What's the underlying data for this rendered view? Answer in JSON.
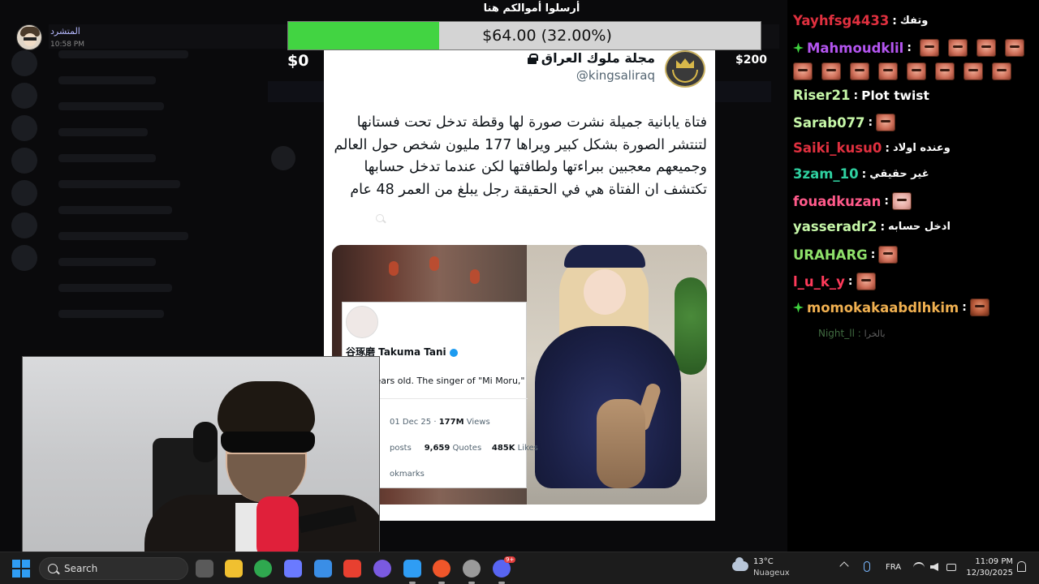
{
  "streamer": {
    "name": "المتشرد",
    "time": "10:58 PM"
  },
  "donation": {
    "title": "أرسلوا أموالكم هنا",
    "progress_text": "$64.00 (32.00%)",
    "progress_fraction": 0.32,
    "min_label": "$0",
    "max_label": "$200"
  },
  "tweet": {
    "display_name": "مجلة ملوك العراق",
    "handle": "@kingsaliraq",
    "body": "فتاة يابانية جميلة نشرت صورة لها وقطة تدخل تحت فستانها لتنتشر الصورة بشكل كبير ويراها 177 مليون شخص حول العالم وجميعهم معجبين ببراءتها ولطافتها لكن عندما تدخل حسابها تكتشف ان الفتاة هي في الحقيقة رجل يبلغ من العمر 48 عام",
    "embedded": {
      "name": "谷琢磨 Takuma Tani",
      "bio": "years old. The singer of \"Mi Moru,\"",
      "date": "01 Dec 25 · ",
      "views_count": "177M",
      "views_label": " Views",
      "posts_label": "posts",
      "quotes_count": "9,659",
      "quotes_label": " Quotes",
      "likes_count": "485K",
      "likes_label": " Likes",
      "bookmarks_label": "okmarks"
    }
  },
  "chat": {
    "messages": [
      {
        "user": "Yayhfsg4433",
        "color": "#e0303f",
        "message": "وتفك",
        "lang": "ar"
      },
      {
        "user": "Mahmoudklil",
        "color": "#b455f0",
        "badge": true,
        "emotes": 4
      },
      {
        "user": "Riser21",
        "color": "#c6f7a8",
        "message": "Plot twist",
        "lang": "en"
      },
      {
        "user": "Sarab077",
        "color": "#c6f7a8",
        "emotes": 1
      },
      {
        "user": "Saiki_kusu0",
        "color": "#e0303f",
        "message": "وعنده اولاد",
        "lang": "ar"
      },
      {
        "user": "3zam_10",
        "color": "#2fd0a0",
        "message": "غير حقيقي",
        "lang": "ar"
      },
      {
        "user": "fouadkuzan",
        "color": "#ff5a8a",
        "emotes": 1,
        "emote_style": "pale"
      },
      {
        "user": "yasseradr2",
        "color": "#c6f7a8",
        "message": "ادخل حسابه",
        "lang": "ar"
      },
      {
        "user": "URAHARG",
        "color": "#8ee06a",
        "emotes": 1
      },
      {
        "user": "l_u_k_y",
        "color": "#ff3a5a",
        "emotes": 1
      },
      {
        "user": "momokakaabdlhkim",
        "color": "#f0b050",
        "badge": true,
        "emotes": 1,
        "emote_style": "dark"
      }
    ],
    "emote_row_count": 8,
    "faded": {
      "user": "Night_ll",
      "message": "بالخرا"
    }
  },
  "taskbar": {
    "search_placeholder": "Search",
    "weather_temp": "13°C",
    "weather_desc": "Nuageux",
    "language": "FRA",
    "time": "11:09 PM",
    "date": "12/30/2025",
    "discord_badge": "9+",
    "apps": [
      "file-explorer-icon",
      "folder-icon",
      "xbox-icon",
      "copilot-icon",
      "store-icon",
      "app-red-icon",
      "app-purple-icon",
      "edge-icon",
      "brave-icon",
      "obs-icon",
      "discord-icon"
    ],
    "colors": {
      "accent": "#2f9df4"
    }
  }
}
